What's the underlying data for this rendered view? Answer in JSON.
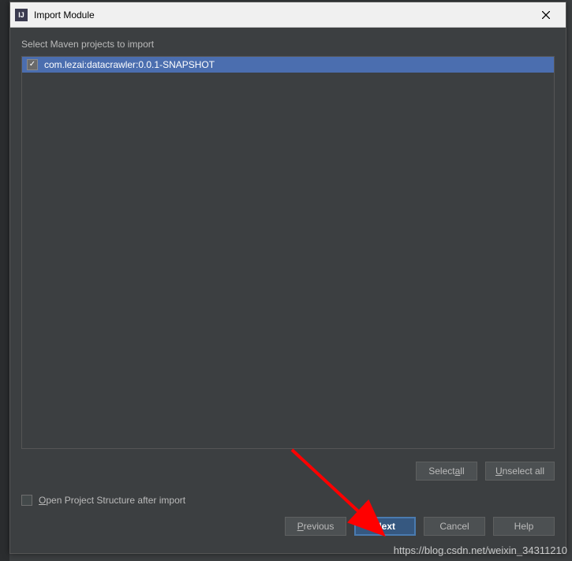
{
  "titlebar": {
    "title": "Import Module"
  },
  "section_label": "Select Maven projects to import",
  "projects": [
    {
      "checked": true,
      "label": "com.lezai:datacrawler:0.0.1-SNAPSHOT"
    }
  ],
  "buttons": {
    "select_all_pre": "Select ",
    "select_all_u": "a",
    "select_all_post": "ll",
    "unselect_all_u": "U",
    "unselect_all_post": "nselect all",
    "previous_u": "P",
    "previous_post": "revious",
    "next_u": "N",
    "next_post": "ext",
    "cancel": "Cancel",
    "help": "Help"
  },
  "open_structure": {
    "pre": "",
    "u": "O",
    "post": "pen Project Structure after import"
  },
  "watermark": "https://blog.csdn.net/weixin_34311210"
}
